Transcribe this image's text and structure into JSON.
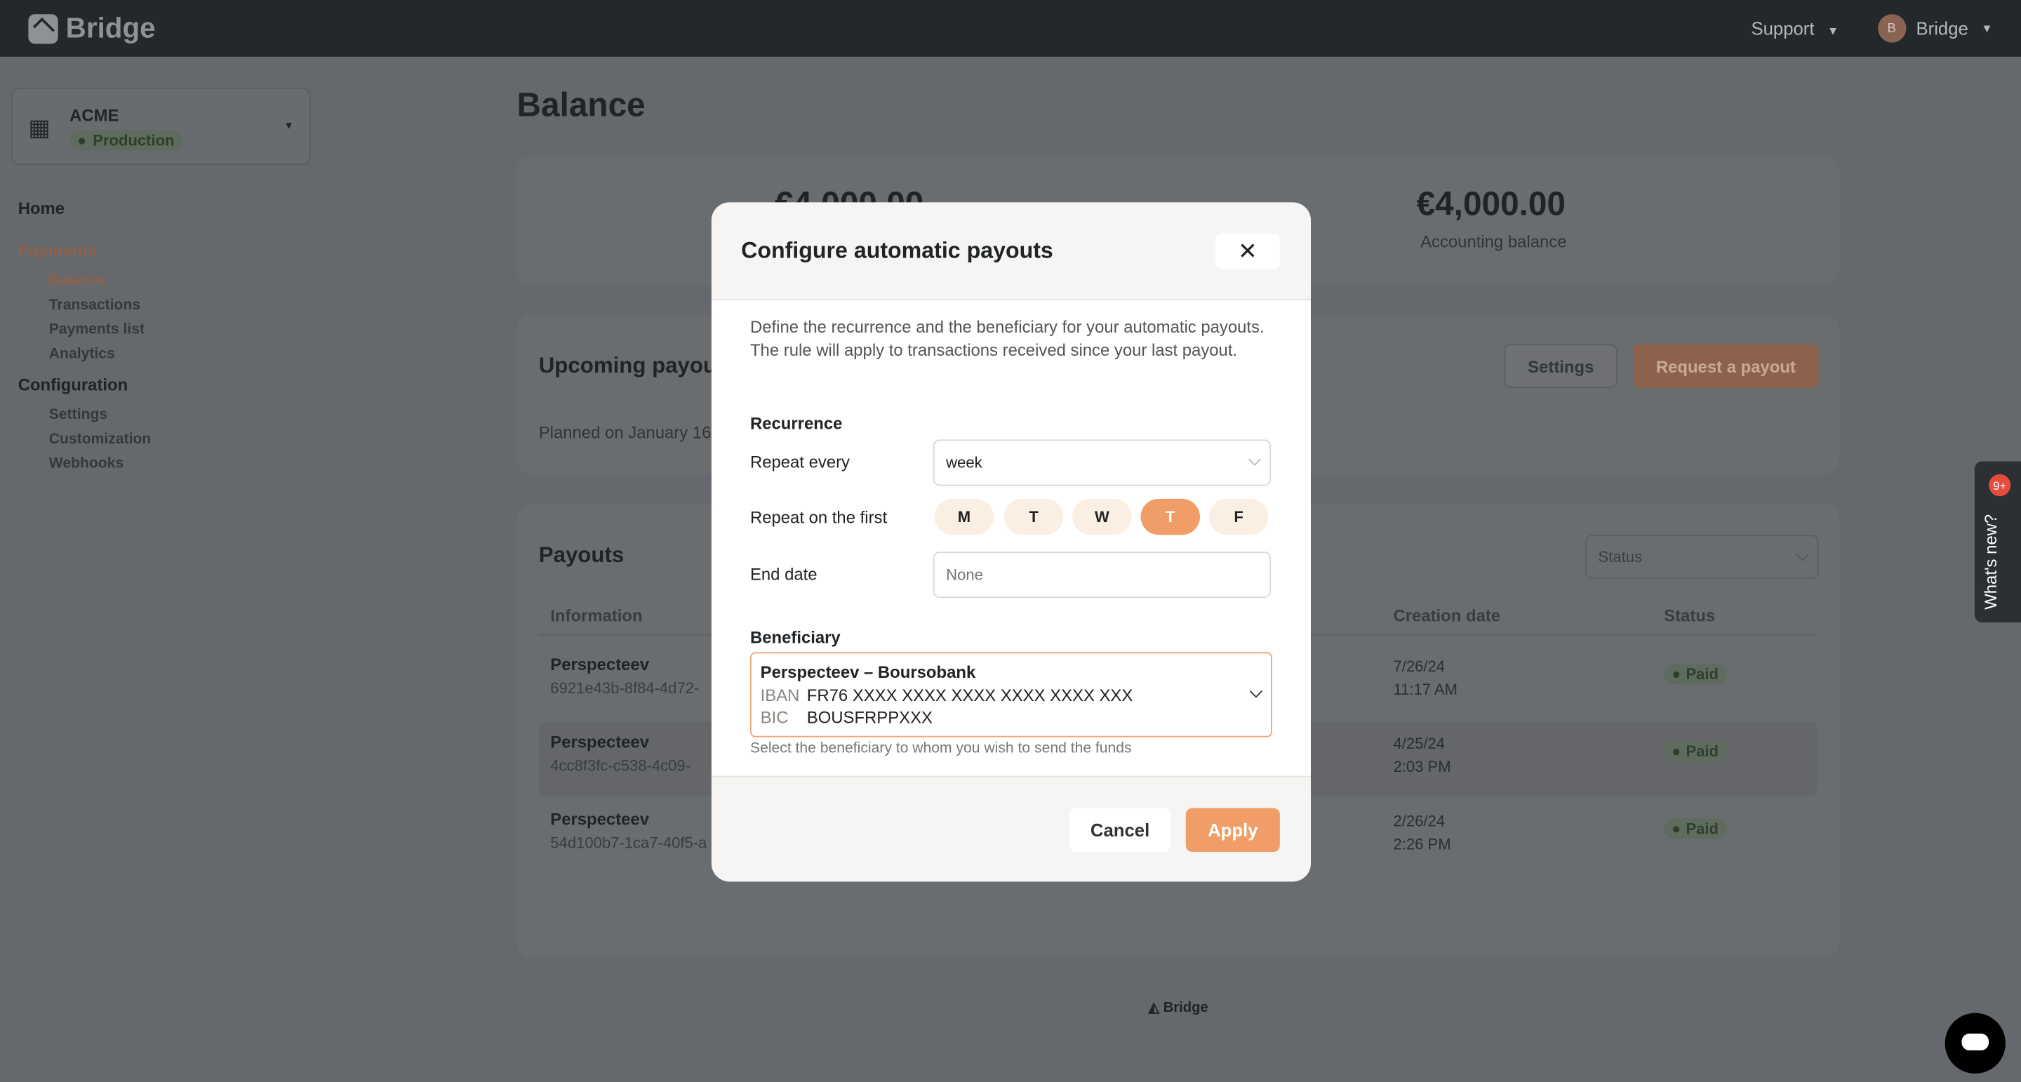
{
  "topbar": {
    "brand": "Bridge",
    "support": "Support",
    "user": "Bridge",
    "user_initial": "B"
  },
  "org": {
    "name": "ACME",
    "env": "Production"
  },
  "sidebar": {
    "home": "Home",
    "payments": "Payments",
    "payments_items": [
      "Balance",
      "Transactions",
      "Payments list",
      "Analytics"
    ],
    "configuration": "Configuration",
    "configuration_items": [
      "Settings",
      "Customization",
      "Webhooks"
    ]
  },
  "main": {
    "title": "Balance",
    "balance_left": "€4,000.00",
    "balance_right": "€4,000.00",
    "balance_right_label": "Accounting balance",
    "upcoming_title": "Upcoming payouts",
    "planned": "Planned on January 16",
    "settings_btn": "Settings",
    "request_btn": "Request a payout",
    "payouts_title": "Payouts",
    "status_filter": "Status",
    "columns": [
      "Information",
      "Creation date",
      "Status"
    ],
    "rows": [
      {
        "name": "Perspecteev",
        "id": "6921e43b-8f84-4d72-",
        "date": "7/26/24",
        "time": "11:17 AM",
        "status": "Paid"
      },
      {
        "name": "Perspecteev",
        "id": "4cc8f3fc-c538-4c09-",
        "date": "4/25/24",
        "time": "2:03 PM",
        "status": "Paid"
      },
      {
        "name": "Perspecteev",
        "id": "54d100b7-1ca7-40f5-a",
        "date": "2/26/24",
        "time": "2:26 PM",
        "status": "Paid"
      }
    ]
  },
  "modal": {
    "title": "Configure automatic payouts",
    "description": "Define the recurrence and the beneficiary for your automatic payouts. The rule will apply to transactions received since your last payout.",
    "recurrence": "Recurrence",
    "repeat_every": "Repeat every",
    "repeat_every_value": "week",
    "repeat_on": "Repeat on the first",
    "days": [
      "M",
      "T",
      "W",
      "T",
      "F"
    ],
    "selected_day_index": 3,
    "end_date": "End date",
    "end_date_placeholder": "None",
    "beneficiary": "Beneficiary",
    "beneficiary_name": "Perspecteev – Boursobank",
    "iban_label": "IBAN",
    "iban": "FR76 XXXX XXXX XXXX XXXX XXXX XXX",
    "bic_label": "BIC",
    "bic": "BOUSFRPPXXX",
    "hint": "Select the beneficiary to whom you wish to send the funds",
    "cancel": "Cancel",
    "apply": "Apply"
  },
  "whats_new": {
    "label": "What's new?",
    "badge": "9+"
  },
  "footer": {
    "brand": "Bridge"
  },
  "colors": {
    "accent": "#f09d67",
    "topbar": "#2a3034",
    "paid": "#4b6a44"
  }
}
